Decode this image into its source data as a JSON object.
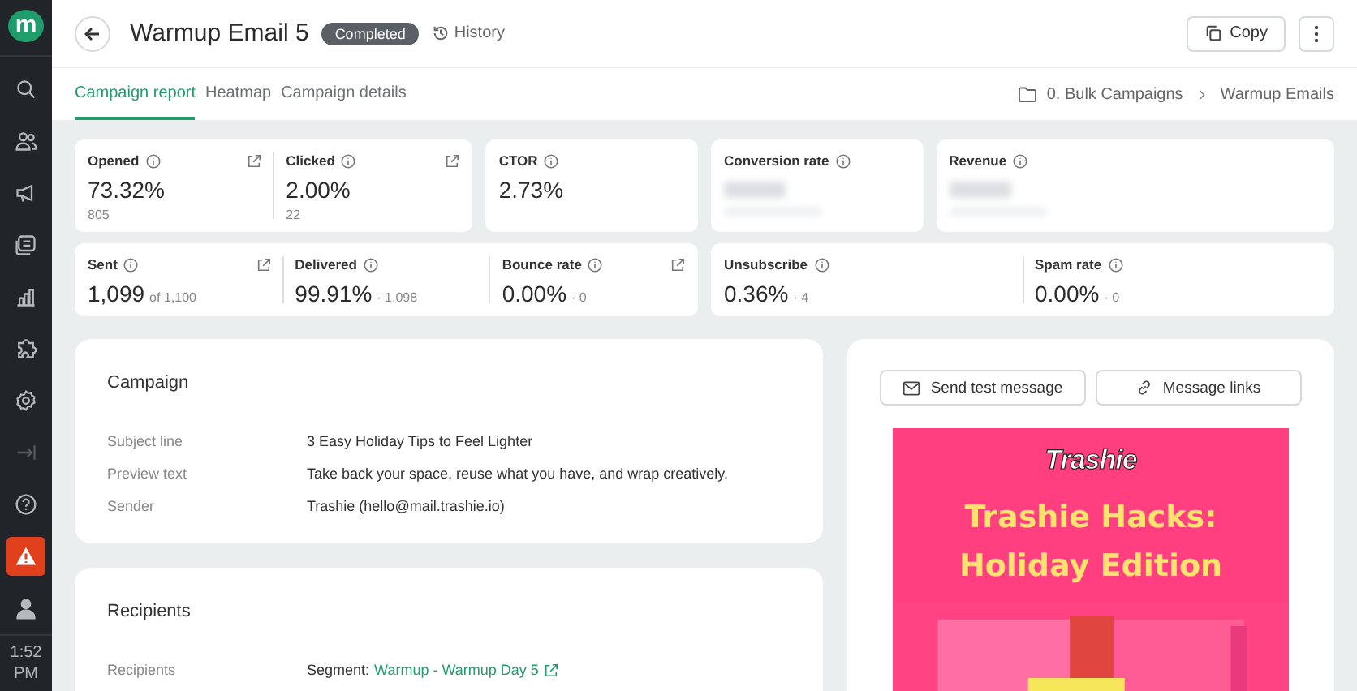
{
  "sidebar": {
    "logo": "m",
    "items": [
      {
        "kind": "nav"
      },
      {
        "kind": "nav"
      },
      {
        "kind": "nav"
      },
      {
        "kind": "nav"
      },
      {
        "kind": "nav"
      },
      {
        "kind": "nav"
      },
      {
        "kind": "nav"
      },
      {
        "kind": "dim"
      },
      {
        "kind": "nav"
      },
      {
        "kind": "alert"
      },
      {
        "kind": "nav"
      }
    ],
    "time": "1:52",
    "ampm": "PM"
  },
  "header": {
    "title": "Warmup Email 5",
    "status": "Completed",
    "history": "History",
    "copy": "Copy"
  },
  "tabs": [
    {
      "label": "Campaign report",
      "selected": true
    },
    {
      "label": "Heatmap",
      "selected": false
    },
    {
      "label": "Campaign details",
      "selected": false
    }
  ],
  "breadcrumb": [
    "0. Bulk Campaigns",
    "Warmup Emails"
  ],
  "metric_rows": [
    {
      "cards": [
        {
          "metrics": [
            {
              "label": "Opened",
              "value": "73.32%",
              "sub": "805",
              "link": true,
              "kind": "plain"
            },
            {
              "label": "Clicked",
              "value": "2.00%",
              "sub": "22",
              "link": true,
              "kind": "plain"
            }
          ]
        },
        {
          "metrics": [
            {
              "label": "CTOR",
              "value": "2.73%",
              "link": false,
              "kind": "plain"
            }
          ]
        },
        {
          "metrics": [
            {
              "label": "Conversion rate",
              "link": false,
              "kind": "blurred"
            }
          ]
        },
        {
          "metrics": [
            {
              "label": "Revenue",
              "link": false,
              "kind": "blurred"
            }
          ]
        }
      ]
    },
    {
      "cards": [
        {
          "metrics": [
            {
              "label": "Sent",
              "value": "1,099",
              "sub": "of 1,100",
              "link": true,
              "kind": "inline"
            },
            {
              "label": "Delivered",
              "value": "99.91%",
              "sub": "· 1,098",
              "link": false,
              "kind": "inline"
            },
            {
              "label": "Bounce rate",
              "value": "0.00%",
              "sub": "· 0",
              "link": true,
              "kind": "inline"
            }
          ]
        },
        {
          "metrics": [
            {
              "label": "Unsubscribe",
              "value": "0.36%",
              "sub": "· 4",
              "link": false,
              "kind": "inline"
            },
            {
              "label": "Spam rate",
              "value": "0.00%",
              "sub": "· 0",
              "link": false,
              "kind": "inline"
            }
          ]
        }
      ]
    }
  ],
  "campaign": {
    "title": "Campaign",
    "rows": [
      {
        "label": "Subject line",
        "value": "3 Easy Holiday Tips to Feel Lighter"
      },
      {
        "label": "Preview text",
        "value": "Take back your space, reuse what you have, and wrap creatively."
      },
      {
        "label": "Sender",
        "value": "Trashie (hello@mail.trashie.io)"
      }
    ]
  },
  "recipients": {
    "title": "Recipients",
    "label": "Recipients",
    "prefix": "Segment:",
    "link": "Warmup - Warmup Day 5"
  },
  "preview": {
    "send_test": "Send test message",
    "links": "Message links",
    "email": {
      "logo": "Trashie",
      "headline": [
        "Trashie Hacks:",
        "Holiday Edition"
      ]
    }
  }
}
